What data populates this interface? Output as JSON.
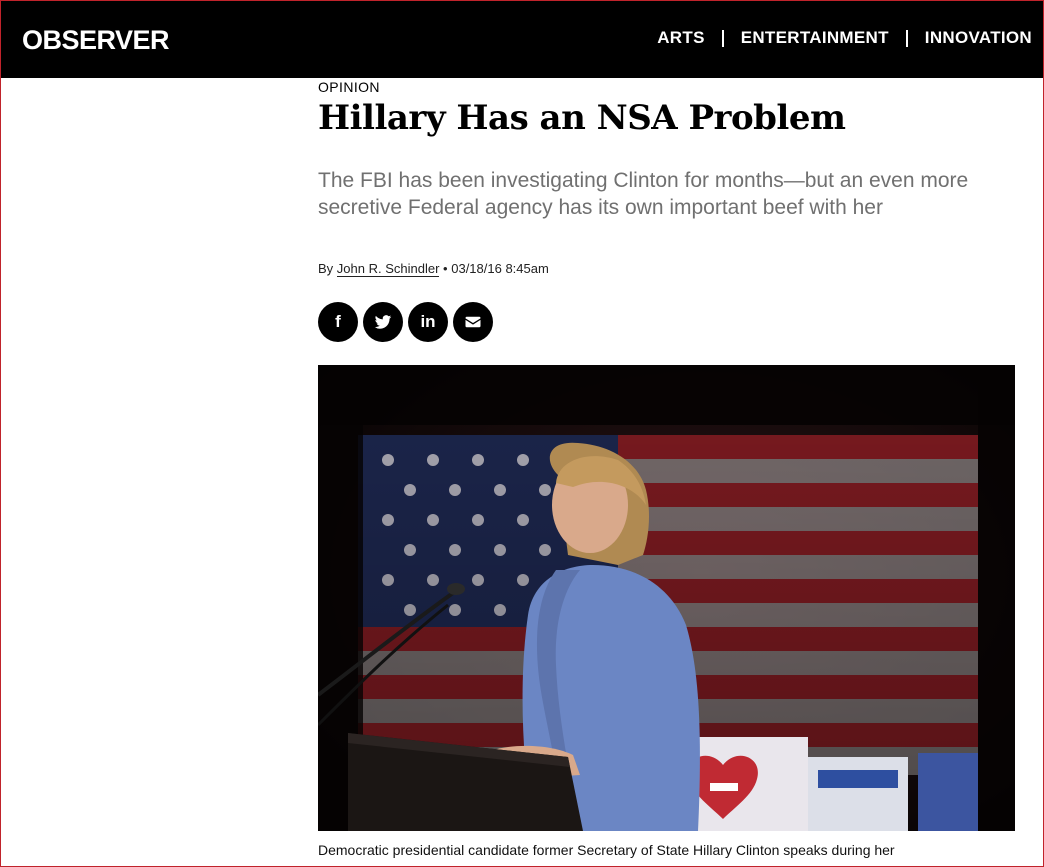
{
  "header": {
    "logo": "OBSERVER",
    "nav": [
      "ARTS",
      "ENTERTAINMENT",
      "INNOVATION"
    ]
  },
  "article": {
    "section": "OPINION",
    "title": "Hillary Has an NSA Problem",
    "dek": "The FBI has been investigating Clinton for months—but an even more secretive Federal agency has its own important beef with her",
    "byline_prefix": "By",
    "author": "John R. Schindler",
    "date_separator": "•",
    "date": "03/18/16 8:45am",
    "caption": "Democratic presidential candidate former Secretary of State Hillary Clinton speaks during her"
  },
  "share": {
    "facebook": "f",
    "twitter": "twitter-icon",
    "linkedin": "in",
    "email": "envelope-icon"
  },
  "colors": {
    "topbar": "#000000",
    "frame_border": "#c0232b",
    "dek_text": "#707070",
    "flag_red": "#8a1d24",
    "flag_blue": "#1f2a55",
    "jacket": "#6b86c4"
  }
}
